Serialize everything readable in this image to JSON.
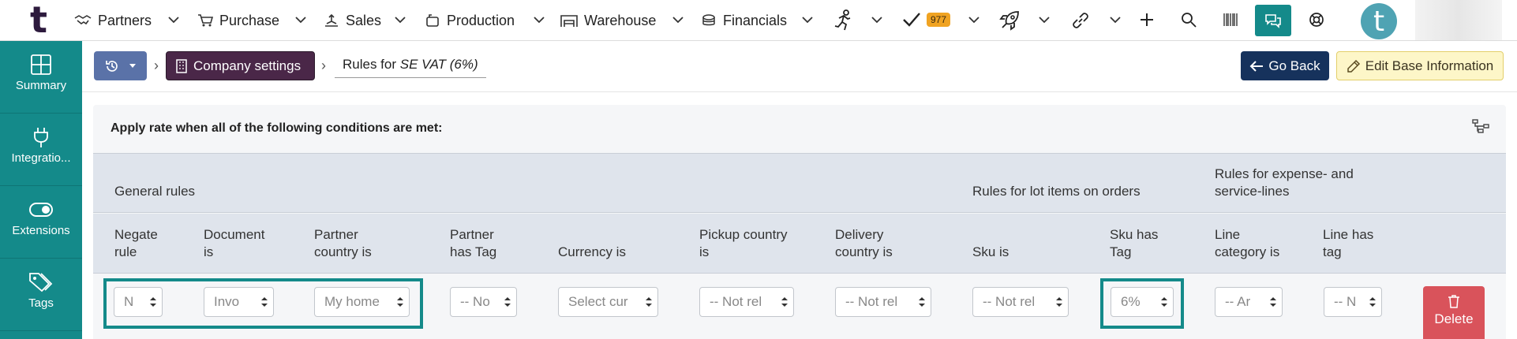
{
  "app": {
    "logo_letter": "t",
    "avatar_letter": "t"
  },
  "nav": {
    "items": [
      {
        "label": "Partners",
        "icon": "handshake-icon"
      },
      {
        "label": "Purchase",
        "icon": "cart-icon"
      },
      {
        "label": "Sales",
        "icon": "sales-icon"
      },
      {
        "label": "Production",
        "icon": "production-icon"
      },
      {
        "label": "Warehouse",
        "icon": "warehouse-icon"
      },
      {
        "label": "Financials",
        "icon": "coins-icon"
      }
    ],
    "task_count": "977"
  },
  "sidebar": {
    "items": [
      {
        "label": "Summary",
        "icon": "grid-icon"
      },
      {
        "label": "Integratio...",
        "icon": "plug-icon"
      },
      {
        "label": "Extensions",
        "icon": "toggle-icon"
      },
      {
        "label": "Tags",
        "icon": "tags-icon"
      }
    ]
  },
  "breadcrumb": {
    "company_settings": "Company settings",
    "current_prefix": "Rules for",
    "current_name": "SE VAT (6%)"
  },
  "actions": {
    "go_back": "Go Back",
    "edit_base": "Edit Base Information",
    "delete": "Delete"
  },
  "panel": {
    "title": "Apply rate when all of the following conditions are met:",
    "groups": {
      "general": "General rules",
      "lot": "Rules for lot items on orders",
      "expense": [
        "Rules for expense- and",
        "service-lines"
      ]
    },
    "columns": [
      [
        "Negate",
        "rule"
      ],
      [
        "Document",
        "is"
      ],
      [
        "Partner",
        "country is"
      ],
      [
        "Partner",
        "has Tag"
      ],
      [
        "",
        "Currency is"
      ],
      [
        "Pickup country",
        "is"
      ],
      [
        "Delivery",
        "country is"
      ],
      [
        "",
        "Sku is"
      ],
      [
        "Sku has",
        "Tag"
      ],
      [
        "Line",
        "category is"
      ],
      [
        "Line has",
        "tag"
      ]
    ],
    "values": [
      "N",
      "Invo",
      "My home",
      "-- No",
      "Select cur",
      "-- Not rel",
      "-- Not rel",
      "-- Not rel",
      "6%",
      "-- Ar",
      "-- N"
    ]
  },
  "colors": {
    "teal": "#148a8a",
    "navy": "#16325c",
    "plum": "#4a2748",
    "danger": "#d9535b",
    "badge": "#f0a322"
  }
}
